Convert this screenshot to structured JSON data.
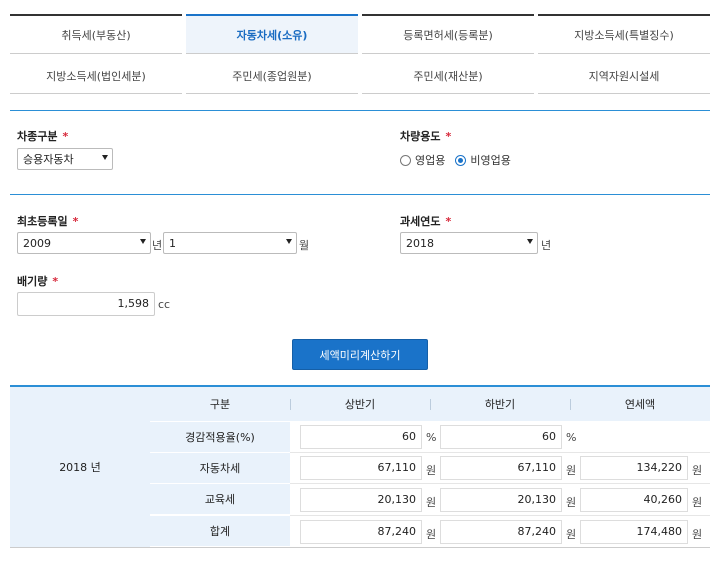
{
  "tabs_row1": [
    {
      "label": "취득세(부동산)",
      "active": false
    },
    {
      "label": "자동차세(소유)",
      "active": true
    },
    {
      "label": "등록면허세(등록분)",
      "active": false
    },
    {
      "label": "지방소득세(특별징수)",
      "active": false
    }
  ],
  "tabs_row2": [
    {
      "label": "지방소득세(법인세분)"
    },
    {
      "label": "주민세(종업원분)"
    },
    {
      "label": "주민세(재산분)"
    },
    {
      "label": "지역자원시설세"
    }
  ],
  "form": {
    "car_type": {
      "label": "차종구분",
      "required": "*",
      "value": "승용자동차"
    },
    "usage": {
      "label": "차량용도",
      "required": "*",
      "options": [
        "영업용",
        "비영업용"
      ],
      "selected": "비영업용"
    },
    "first_reg": {
      "label": "최초등록일",
      "required": "*",
      "year": "2009",
      "year_unit": "년",
      "month": "1",
      "month_unit": "월"
    },
    "tax_year": {
      "label": "과세연도",
      "required": "*",
      "value": "2018",
      "unit": "년"
    },
    "displacement": {
      "label": "배기량",
      "required": "*",
      "value": "1,598",
      "unit": "cc"
    },
    "submit_label": "세액미리계산하기"
  },
  "result": {
    "year_label": "2018 년",
    "headers": [
      "구분",
      "상반기",
      "하반기",
      "연세액"
    ],
    "rows": [
      {
        "label": "경감적용율(%)",
        "first": "60",
        "first_unit": "%",
        "second": "60",
        "second_unit": "%",
        "annual": "",
        "annual_unit": ""
      },
      {
        "label": "자동차세",
        "first": "67,110",
        "first_unit": "원",
        "second": "67,110",
        "second_unit": "원",
        "annual": "134,220",
        "annual_unit": "원"
      },
      {
        "label": "교육세",
        "first": "20,130",
        "first_unit": "원",
        "second": "20,130",
        "second_unit": "원",
        "annual": "40,260",
        "annual_unit": "원"
      },
      {
        "label": "합계",
        "first": "87,240",
        "first_unit": "원",
        "second": "87,240",
        "second_unit": "원",
        "annual": "174,480",
        "annual_unit": "원"
      }
    ]
  },
  "colors": {
    "accent": "#1a73c9",
    "required": "#d7283a",
    "header_bg": "#e9f2fb"
  }
}
